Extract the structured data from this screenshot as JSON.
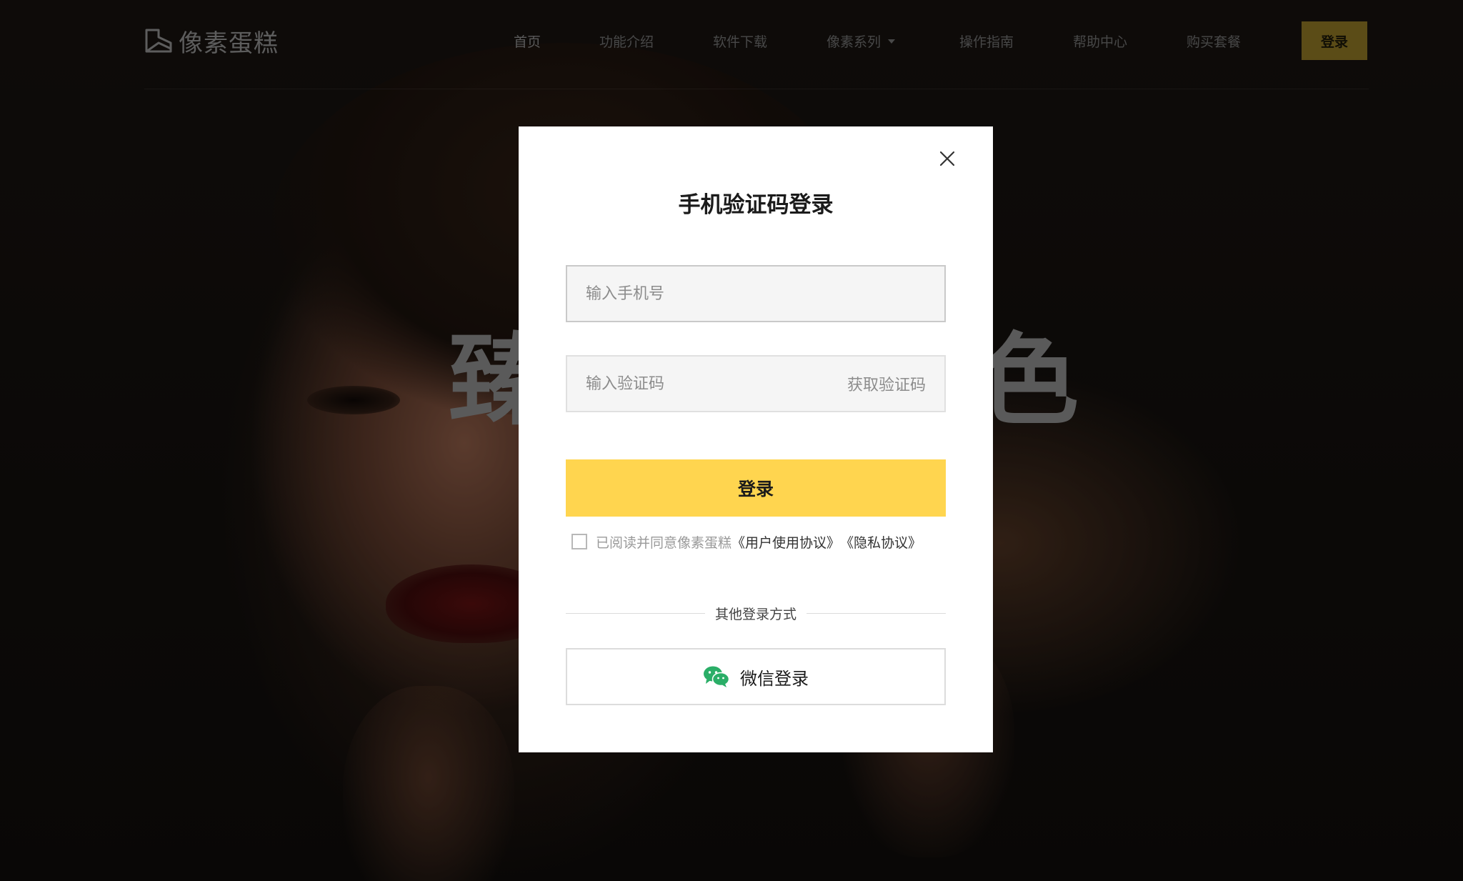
{
  "header": {
    "logo_text": "像素蛋糕",
    "nav": [
      {
        "label": "首页"
      },
      {
        "label": "功能介绍"
      },
      {
        "label": "软件下载"
      },
      {
        "label": "像素系列"
      },
      {
        "label": "操作指南"
      },
      {
        "label": "帮助中心"
      },
      {
        "label": "购买套餐"
      }
    ],
    "login_label": "登录"
  },
  "hero": {
    "left_char": "臻",
    "right_char": "色"
  },
  "modal": {
    "title": "手机验证码登录",
    "phone_placeholder": "输入手机号",
    "code_placeholder": "输入验证码",
    "get_code_label": "获取验证码",
    "submit_label": "登录",
    "agree_text": "已阅读并同意像素蛋糕",
    "user_agreement": "《用户使用协议》",
    "privacy_agreement": "《隐私协议》",
    "other_methods": "其他登录方式",
    "wechat_label": "微信登录"
  },
  "colors": {
    "accent_yellow": "#ffd54f",
    "header_login_bg": "#8d7624",
    "wechat_green": "#2aae67"
  }
}
